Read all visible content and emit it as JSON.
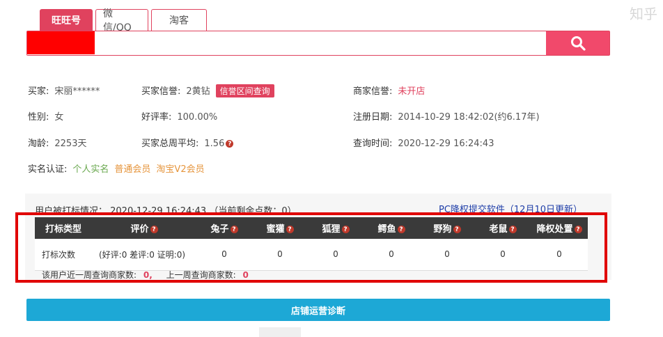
{
  "tabs": [
    {
      "label": "旺旺号",
      "active": true
    },
    {
      "label": "微信/QQ",
      "active": false
    },
    {
      "label": "淘客",
      "active": false
    }
  ],
  "search": {
    "value": "",
    "placeholder": ""
  },
  "buyer": {
    "name_label": "买家:",
    "name_value": "宋丽******",
    "credit_label": "买家信誉:",
    "credit_value": "2黄钻",
    "credit_query_button": "信誉区间查询",
    "merchant_credit_label": "商家信誉:",
    "merchant_credit_value": "未开店",
    "gender_label": "性别:",
    "gender_value": "女",
    "positive_rate_label": "好评率:",
    "positive_rate_value": "100.00%",
    "register_label": "注册日期:",
    "register_value": "2014-10-29 18:42:02(约6.17年)",
    "age_label": "淘龄:",
    "age_value": "2253天",
    "weekly_avg_label": "买家总周平均:",
    "weekly_avg_value": "1.56",
    "query_time_label": "查询时间:",
    "query_time_value": "2020-12-29 16:24:43",
    "realname_label": "实名认证:",
    "realname_badges": [
      "个人实名",
      "普通会员",
      "淘宝V2会员"
    ]
  },
  "marking": {
    "header": "用户被打标情况： 2020-12-29 16:24:43 （当前剩余点数：0）",
    "pc_link": "PC降权提交软件（12月10日更新）",
    "columns": [
      "打标类型",
      "评价",
      "兔子",
      "蜜獾",
      "狐狸",
      "鳄鱼",
      "野狗",
      "老鼠",
      "降权处置"
    ],
    "row": {
      "type": "打标次数",
      "eval": "(好评:0 差评:0 证明:0)",
      "values": [
        "0",
        "0",
        "0",
        "0",
        "0",
        "0",
        "0"
      ]
    },
    "week_text_1": "该用户近一周查询商家数:",
    "week_value_1": "0,",
    "week_text_2": "上一周查询商家数:",
    "week_value_2": "0"
  },
  "diagnosis_button": "店铺运营诊断",
  "watermark": "知乎"
}
